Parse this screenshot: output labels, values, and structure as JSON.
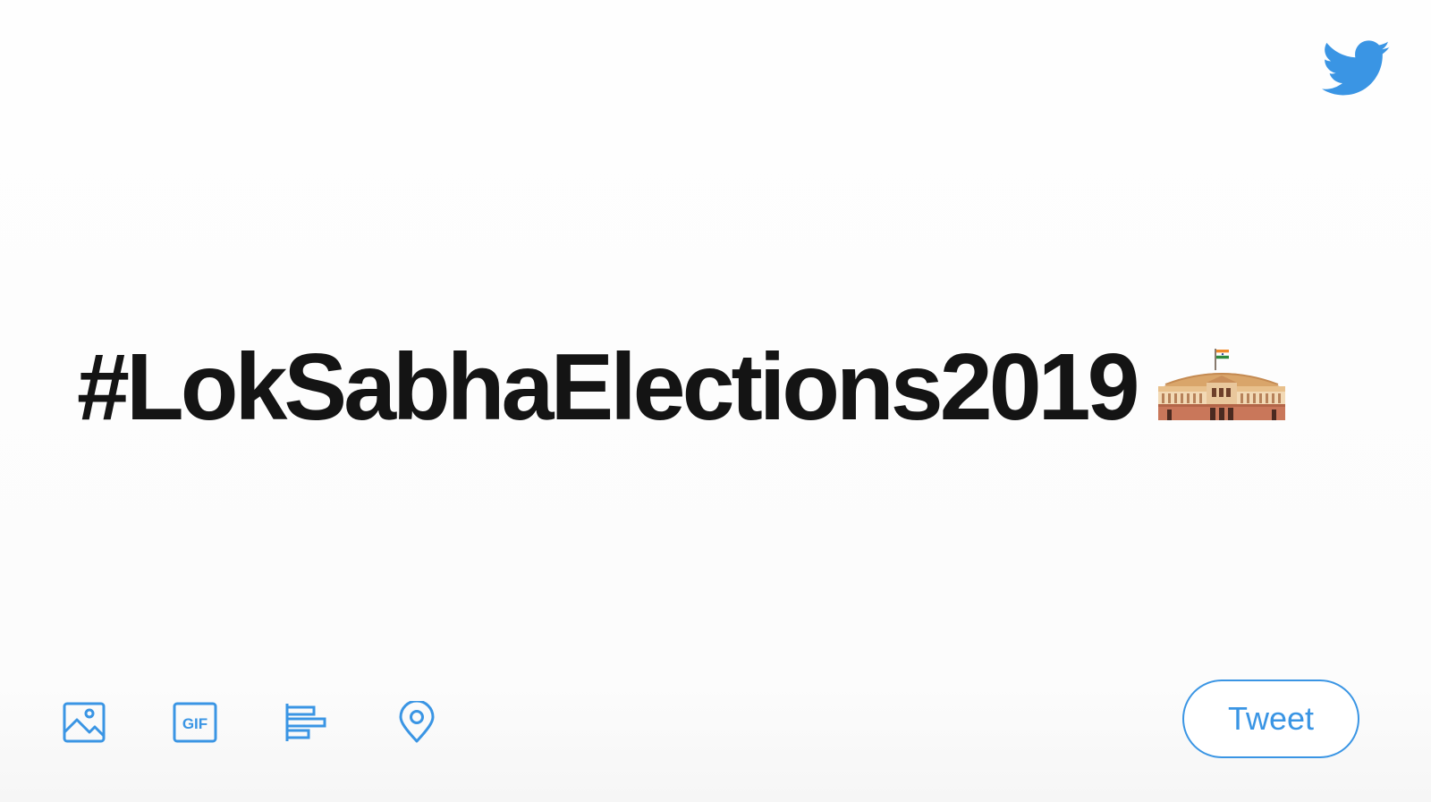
{
  "composer": {
    "text": "#LokSabhaElections2019",
    "hashtag_emoji": "parliament-house-emoji"
  },
  "branding": {
    "logo_icon": "twitter-bird-icon",
    "accent_color": "#3a95e4"
  },
  "toolbar": {
    "tools": [
      {
        "icon": "image-icon"
      },
      {
        "icon": "gif-icon",
        "label": "GIF"
      },
      {
        "icon": "poll-icon"
      },
      {
        "icon": "location-pin-icon"
      }
    ]
  },
  "actions": {
    "tweet_label": "Tweet"
  },
  "colors": {
    "text": "#141414",
    "background": "#fdfdfd"
  }
}
